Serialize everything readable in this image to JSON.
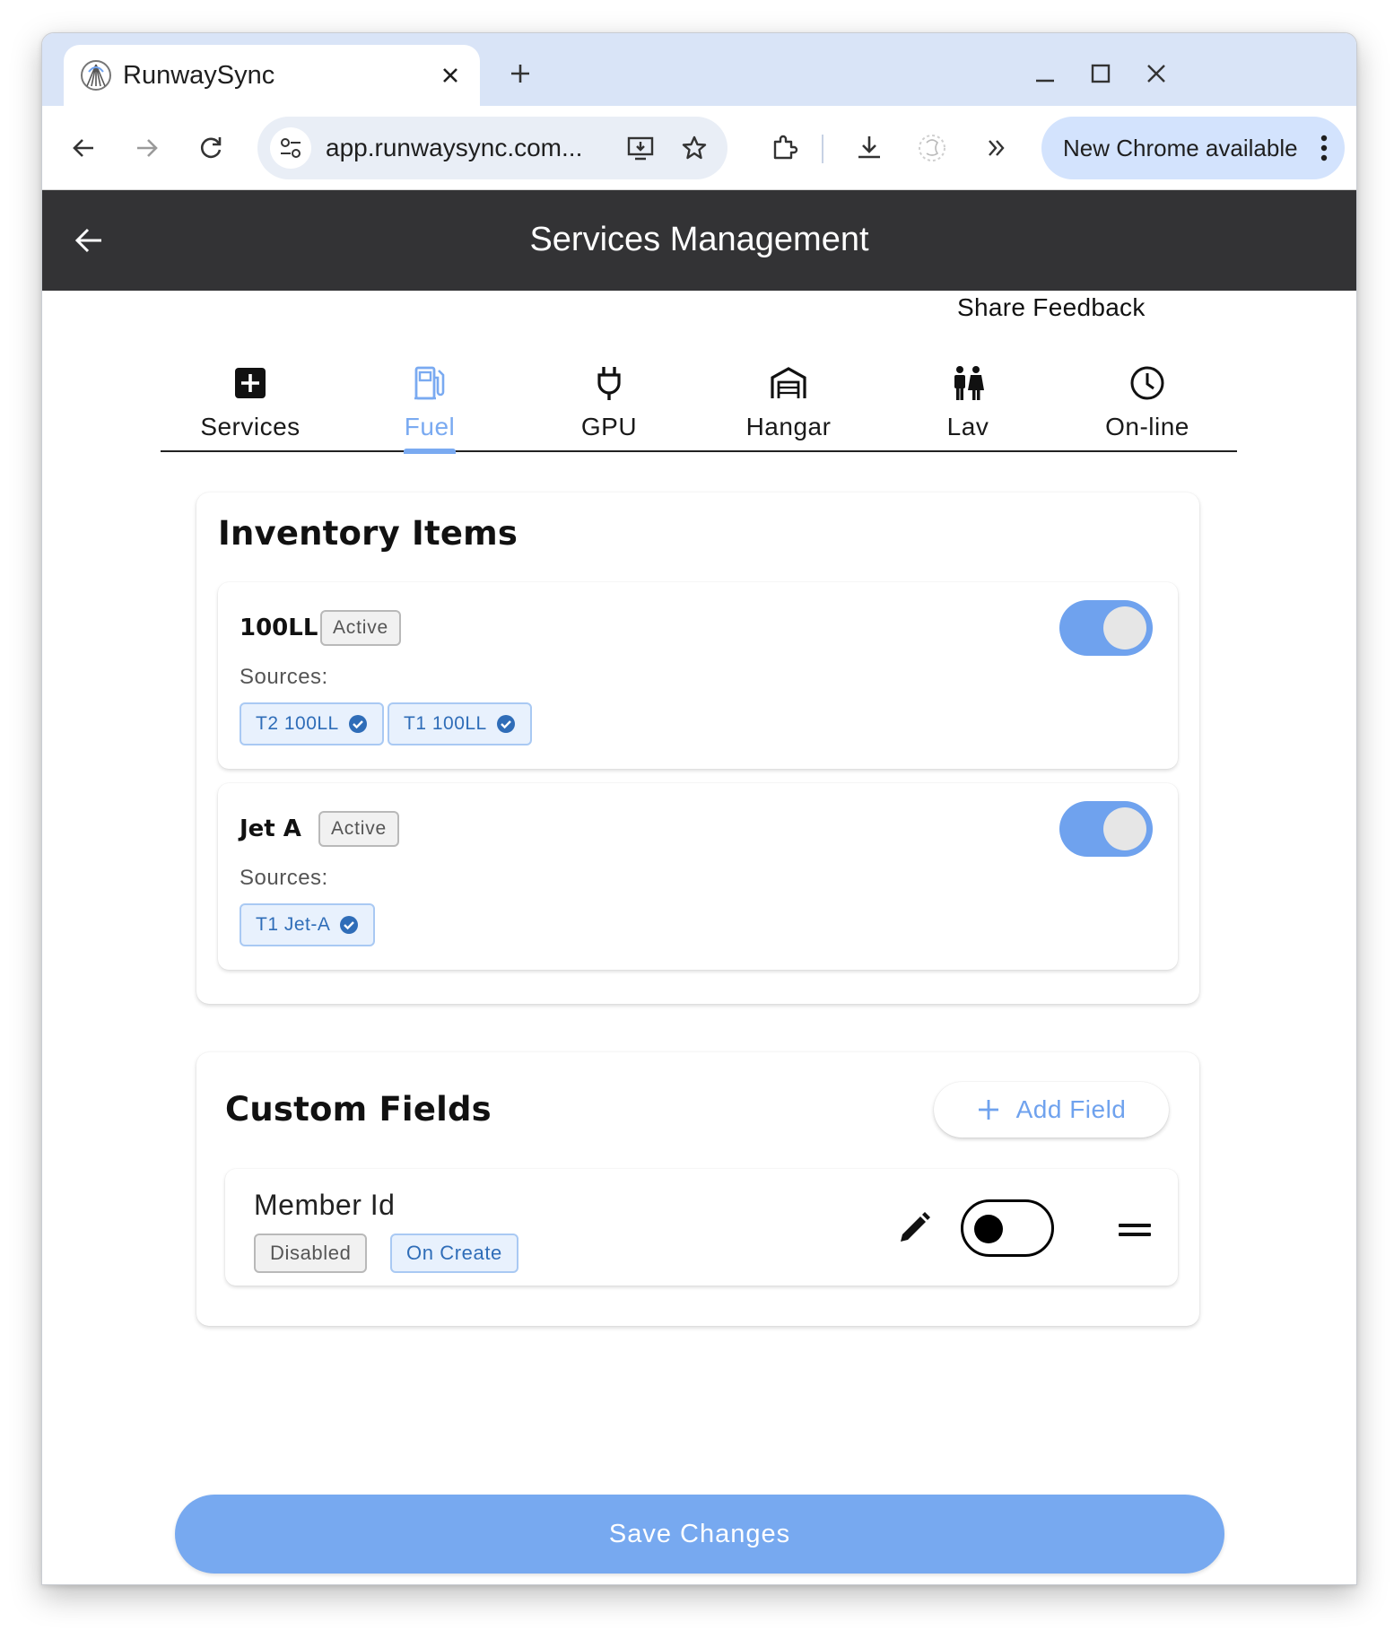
{
  "browser": {
    "tab_title": "RunwaySync",
    "url": "app.runwaysync.com...",
    "update_label": "New Chrome available"
  },
  "app": {
    "title": "Services Management",
    "feedback_label": "Share Feedback"
  },
  "tabs": [
    {
      "label": "Services",
      "icon": "plus-box-icon",
      "active": false
    },
    {
      "label": "Fuel",
      "icon": "fuel-pump-icon",
      "active": true
    },
    {
      "label": "GPU",
      "icon": "power-plug-icon",
      "active": false
    },
    {
      "label": "Hangar",
      "icon": "hangar-icon",
      "active": false
    },
    {
      "label": "Lav",
      "icon": "restroom-icon",
      "active": false
    },
    {
      "label": "On-line",
      "icon": "clock-icon",
      "active": false
    }
  ],
  "inventory": {
    "title": "Inventory Items",
    "sources_label": "Sources:",
    "items": [
      {
        "name": "100LL",
        "status": "Active",
        "enabled": true,
        "sources": [
          "T2 100LL",
          "T1 100LL"
        ]
      },
      {
        "name": "Jet A",
        "status": "Active",
        "enabled": true,
        "sources": [
          "T1 Jet-A"
        ]
      }
    ]
  },
  "custom_fields": {
    "title": "Custom Fields",
    "add_label": "Add Field",
    "fields": [
      {
        "name": "Member Id",
        "state": "Disabled",
        "trigger": "On Create",
        "enabled": false
      }
    ]
  },
  "save_label": "Save Changes",
  "colors": {
    "accent": "#77a9f0",
    "header_bg": "#333335",
    "chip_blue": "#2f6db8"
  }
}
